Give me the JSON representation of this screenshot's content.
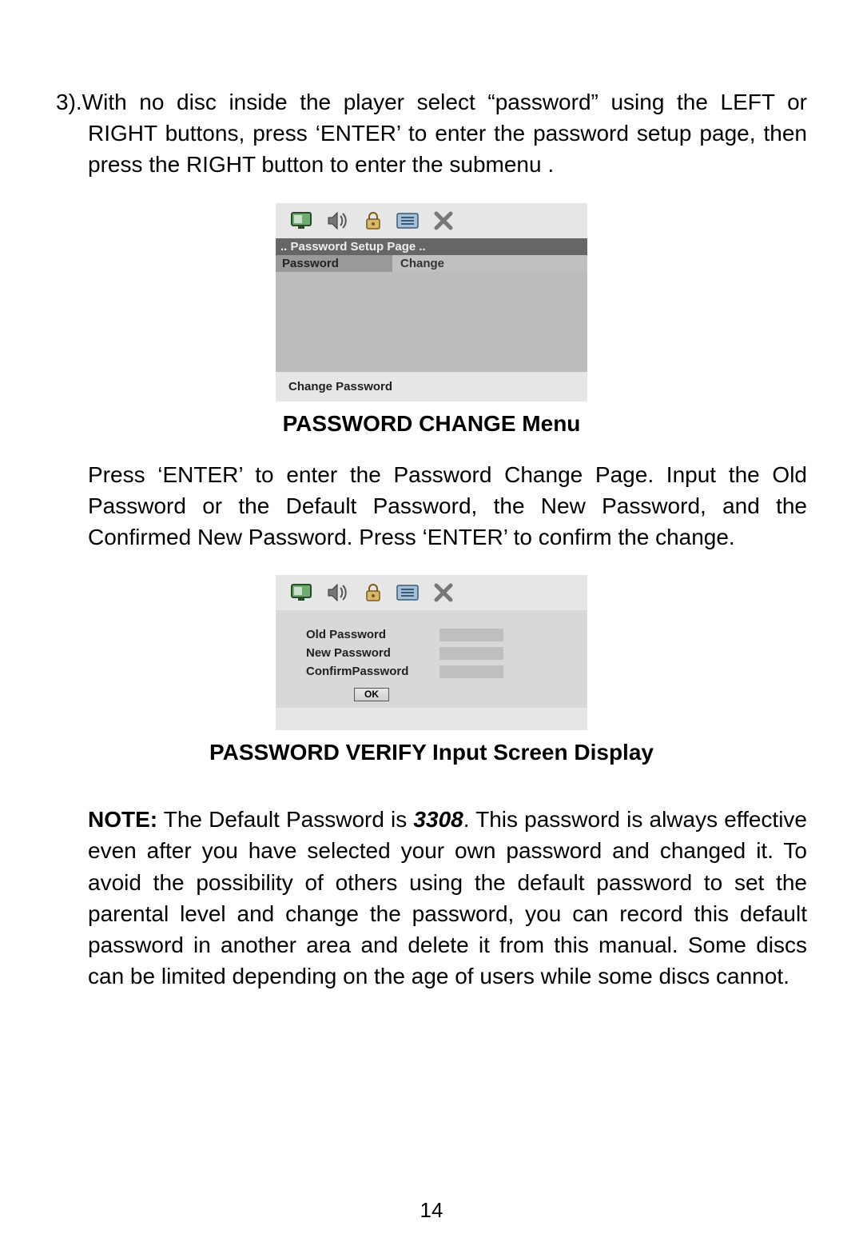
{
  "step3_text": "3).With no disc inside the player select “password” using the  LEFT or RIGHT buttons, press ‘ENTER’ to enter the password setup page, then press the RIGHT button to enter the submenu .",
  "screenshot1": {
    "title_strip": "..  Password  Setup  Page  ..",
    "row_label": "Password",
    "row_value": "Change",
    "footer": "Change  Password"
  },
  "caption1": "PASSWORD CHANGE Menu",
  "para_change": "Press ‘ENTER’ to enter the Password Change Page. Input the Old Password or the Default Password, the New Password, and the Confirmed New Password. Press ‘ENTER’ to confirm the change.",
  "screenshot2": {
    "old_label": "Old  Password",
    "new_label": "New  Password",
    "confirm_label": "ConfirmPassword",
    "ok_label": "OK"
  },
  "caption2": "PASSWORD VERIFY Input Screen Display",
  "note_label": "NOTE:",
  "note_prefix": " The Default Password is ",
  "default_password": "3308",
  "note_suffix": ".   This password  is always effective even after you have selected your own password  and changed it.  To  avoid  the  possibility  of  others using  the  default  password  to set the parental level  and change the password, you can  record  this  default password in another area  and delete it from this  manual. Some  discs can be  limited  depending  on the age of users while some discs cannot.",
  "page_number": "14",
  "icon_names": [
    "monitor-icon",
    "speaker-icon",
    "lock-icon",
    "preferences-icon",
    "close-icon"
  ]
}
